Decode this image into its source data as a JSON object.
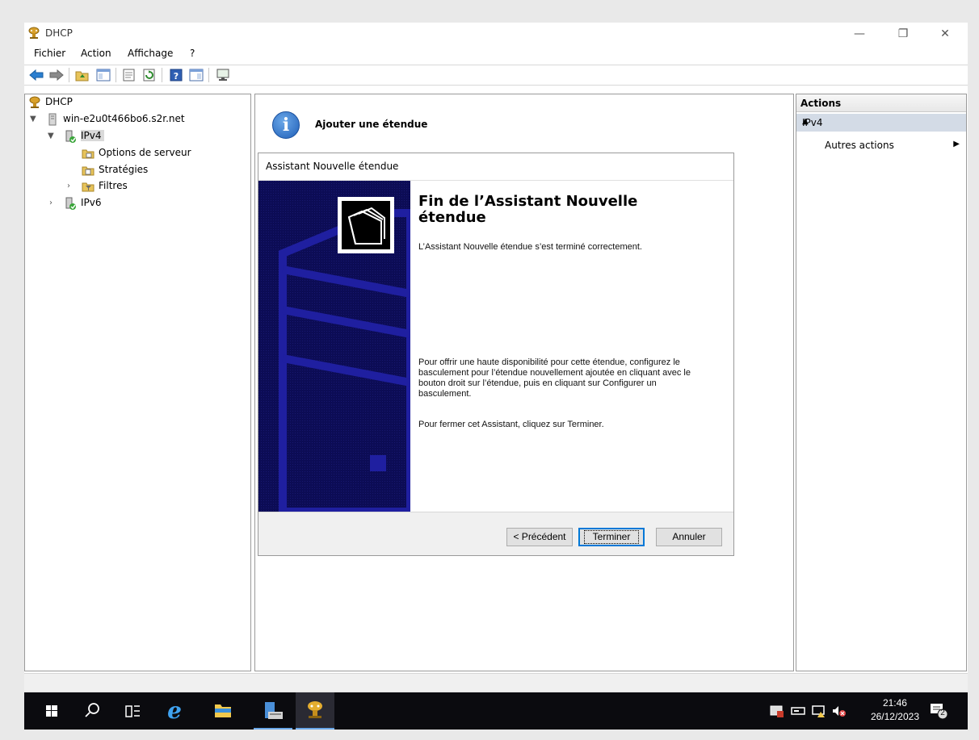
{
  "window": {
    "title": "DHCP",
    "minimize": "—",
    "restore": "❐",
    "close": "✕"
  },
  "menu": {
    "items": [
      "Fichier",
      "Action",
      "Affichage",
      "?"
    ]
  },
  "tree": {
    "root": "DHCP",
    "server": "win-e2u0t466bo6.s2r.net",
    "ipv4": "IPv4",
    "server_options": "Options de serveur",
    "policies": "Stratégies",
    "filters": "Filtres",
    "ipv6": "IPv6"
  },
  "center": {
    "header_title": "Ajouter une étendue",
    "info_glyph": "i"
  },
  "wizard": {
    "title": "Assistant Nouvelle étendue",
    "heading": "Fin de l’Assistant Nouvelle étendue",
    "success_text": "L’Assistant Nouvelle étendue s’est terminé correctement.",
    "failover_text": "Pour offrir une haute disponibilité pour cette étendue, configurez le basculement pour l’étendue nouvellement ajoutée en cliquant avec le bouton droit sur l’étendue, puis en cliquant sur Configurer un basculement.",
    "close_text": "Pour fermer cet Assistant, cliquez sur Terminer.",
    "back_button": "< Précédent",
    "finish_button": "Terminer",
    "cancel_button": "Annuler"
  },
  "actions": {
    "header": "Actions",
    "section": "IPv4",
    "section_arrow": "▲",
    "more_actions": "Autres actions",
    "more_arrow": "▶"
  },
  "taskbar": {
    "time": "21:46",
    "date": "26/12/2023",
    "notification_count": "2"
  },
  "colors": {
    "wizard_banner": "#0c0c55",
    "accent": "#0078d7",
    "actions_selected": "#d3dbe6",
    "taskbar": "#0b0b0f"
  }
}
